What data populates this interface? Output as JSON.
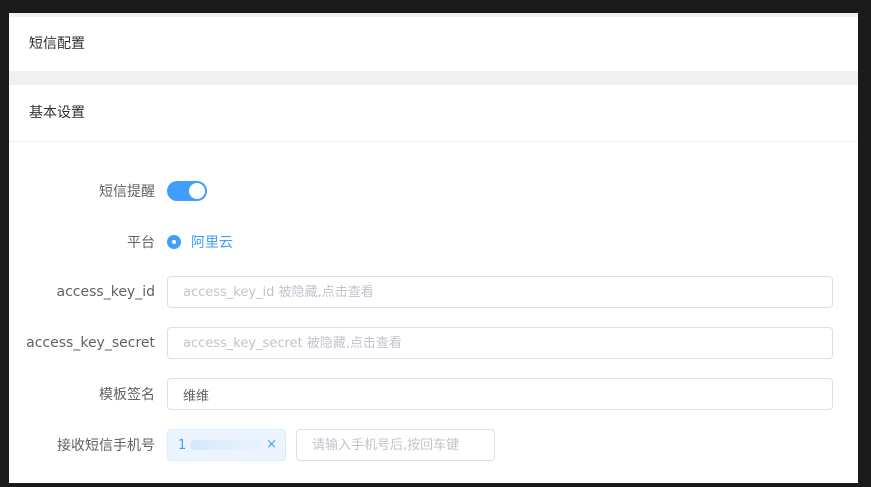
{
  "sms_card": {
    "title": "短信配置"
  },
  "basic_card": {
    "title": "基本设置"
  },
  "form": {
    "sms_alert": {
      "label": "短信提醒",
      "enabled": true
    },
    "platform": {
      "label": "平台",
      "option": "阿里云"
    },
    "access_key_id": {
      "label": "access_key_id",
      "placeholder": "access_key_id 被隐藏,点击查看",
      "value": ""
    },
    "access_key_secret": {
      "label": "access_key_secret",
      "placeholder": "access_key_secret 被隐藏,点击查看",
      "value": ""
    },
    "template_sign": {
      "label": "模板签名",
      "value": "维维"
    },
    "receive_phone": {
      "label": "接收短信手机号",
      "tag_text": "1",
      "tag_close": "×",
      "input_placeholder": "请输入手机号后,按回车键"
    }
  },
  "colors": {
    "accent": "#409eff",
    "label": "#606266",
    "border": "#dcdfe6"
  }
}
